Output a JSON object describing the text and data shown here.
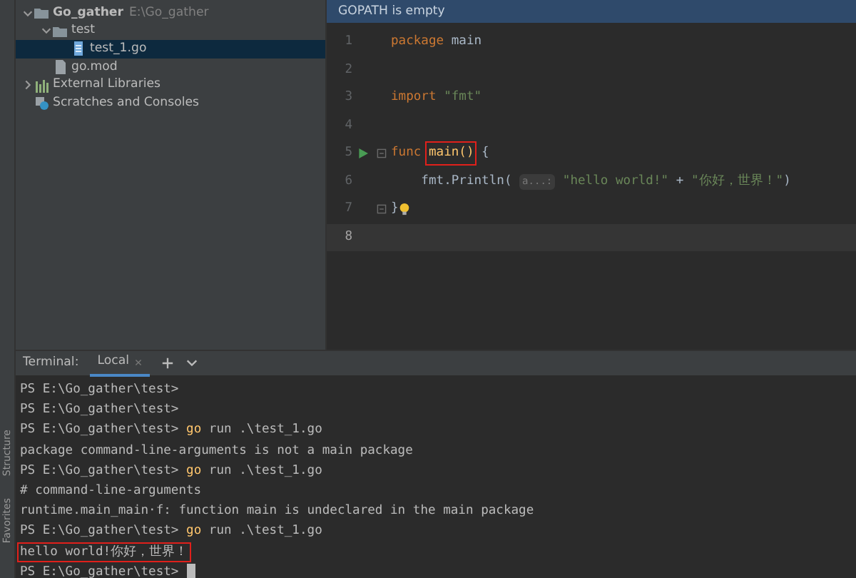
{
  "side_tabs": [
    {
      "label": "Structure"
    },
    {
      "label": "Favorites"
    }
  ],
  "project_tree": [
    {
      "name": "Go_gather",
      "path": "E:\\Go_gather",
      "kind": "folder",
      "expanded": true,
      "selected": false,
      "children": [
        {
          "name": "test",
          "kind": "folder",
          "expanded": true,
          "selected": false,
          "children": [
            {
              "name": "test_1.go",
              "kind": "gofile",
              "selected": true
            }
          ]
        },
        {
          "name": "go.mod",
          "kind": "file",
          "selected": false
        }
      ]
    },
    {
      "name": "External Libraries",
      "kind": "library",
      "expanded": false,
      "selected": false
    },
    {
      "name": "Scratches and Consoles",
      "kind": "scratch",
      "selected": false
    }
  ],
  "editor": {
    "banner": "GOPATH is empty",
    "lines": [
      {
        "number": "1",
        "current": false,
        "tokens": [
          {
            "kind": "keyword",
            "text": "package"
          },
          {
            "kind": "plain",
            "text": " main"
          }
        ]
      },
      {
        "number": "2",
        "current": false
      },
      {
        "number": "3",
        "current": false,
        "tokens": [
          {
            "kind": "keyword",
            "text": "import"
          },
          {
            "kind": "string",
            "text": " \"fmt\""
          }
        ]
      },
      {
        "number": "4",
        "current": false
      },
      {
        "number": "5",
        "current": false,
        "run": true,
        "fold": true,
        "tokens": [
          {
            "kind": "keyword",
            "text": "func "
          },
          {
            "kind": "func",
            "text": "main()",
            "highlighted": true
          },
          {
            "kind": "plain",
            "text": " {"
          }
        ]
      },
      {
        "number": "6",
        "current": false,
        "tokens": [
          {
            "kind": "plain",
            "text": "    fmt.Println( "
          },
          {
            "kind": "hint",
            "text": "a...:"
          },
          {
            "kind": "string",
            "text": " \"hello world!\""
          },
          {
            "kind": "plain",
            "text": " + "
          },
          {
            "kind": "string",
            "text": "\"你好，世界！\""
          },
          {
            "kind": "plain",
            "text": ")"
          }
        ]
      },
      {
        "number": "7",
        "current": false,
        "fold": true,
        "bulb": true,
        "tokens": [
          {
            "kind": "plain",
            "text": "}"
          }
        ]
      },
      {
        "number": "8",
        "current": true
      }
    ]
  },
  "terminal": {
    "label": "Terminal:",
    "tabs": [
      {
        "label": "Local",
        "selected": true
      }
    ],
    "lines": [
      {
        "tokens": [
          {
            "kind": "prompt",
            "text": "PS E:\\Go_gather\\test>"
          }
        ]
      },
      {
        "tokens": [
          {
            "kind": "prompt",
            "text": "PS E:\\Go_gather\\test>"
          }
        ]
      },
      {
        "tokens": [
          {
            "kind": "prompt",
            "text": "PS E:\\Go_gather\\test> "
          },
          {
            "kind": "command",
            "text": "go"
          },
          {
            "kind": "output",
            "text": " run .\\test_1.go"
          }
        ]
      },
      {
        "tokens": [
          {
            "kind": "output",
            "text": "package command-line-arguments is not a main package"
          }
        ]
      },
      {
        "tokens": [
          {
            "kind": "prompt",
            "text": "PS E:\\Go_gather\\test> "
          },
          {
            "kind": "command",
            "text": "go"
          },
          {
            "kind": "output",
            "text": " run .\\test_1.go"
          }
        ]
      },
      {
        "tokens": [
          {
            "kind": "output",
            "text": "# command-line-arguments"
          }
        ]
      },
      {
        "tokens": [
          {
            "kind": "output",
            "text": "runtime.main_main·f: function main is undeclared in the main package"
          }
        ]
      },
      {
        "tokens": [
          {
            "kind": "prompt",
            "text": "PS E:\\Go_gather\\test> "
          },
          {
            "kind": "command",
            "text": "go"
          },
          {
            "kind": "output",
            "text": " run .\\test_1.go"
          }
        ]
      },
      {
        "tokens": [
          {
            "kind": "output",
            "text": "hello world!你好，世界！",
            "highlighted": true
          }
        ]
      },
      {
        "cursor": true,
        "tokens": [
          {
            "kind": "prompt",
            "text": "PS E:\\Go_gather\\test> "
          }
        ]
      }
    ]
  }
}
